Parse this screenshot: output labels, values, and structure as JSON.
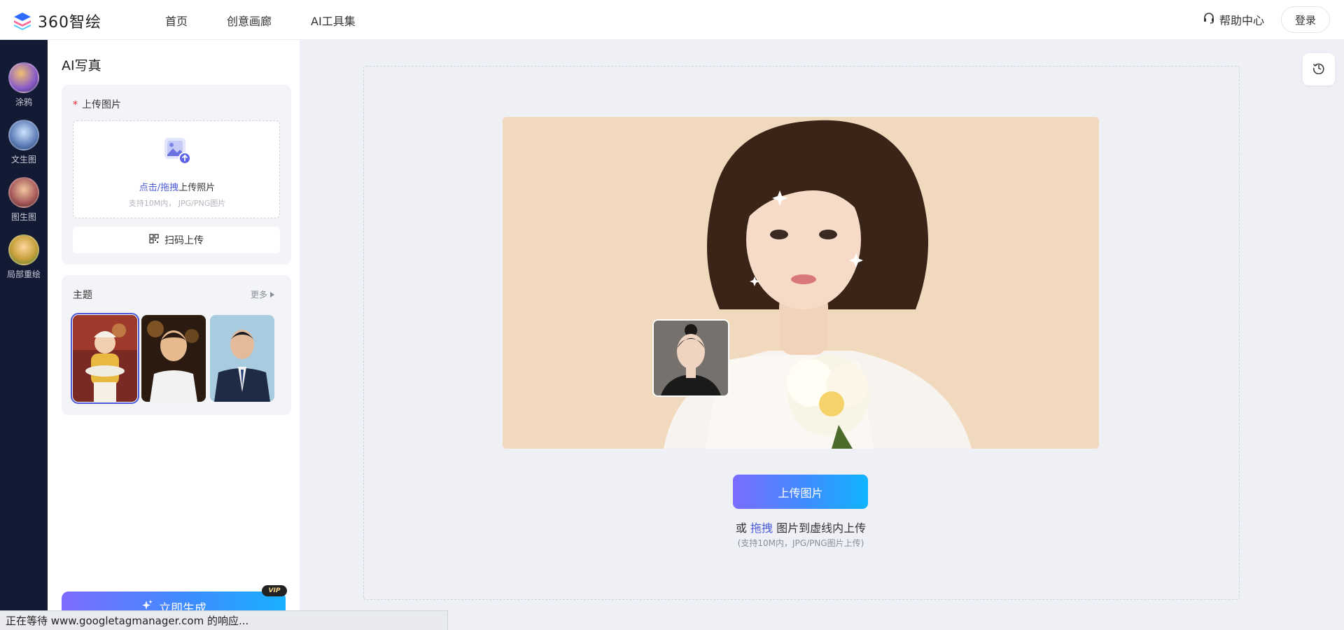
{
  "header": {
    "logo_text": "360智绘",
    "nav": [
      "首页",
      "创意画廊",
      "AI工具集"
    ],
    "help": "帮助中心",
    "login": "登录"
  },
  "rail": [
    {
      "label": "涂鸦",
      "color": "#8a5cc7"
    },
    {
      "label": "文生图",
      "color": "#5f7fb8"
    },
    {
      "label": "图生图",
      "color": "#a65a5a"
    },
    {
      "label": "局部重绘",
      "color": "#c7a13b"
    }
  ],
  "side": {
    "title": "AI写真",
    "upload_label": "上传图片",
    "required_mark": "*",
    "drop_link": "点击/拖拽",
    "drop_text": "上传照片",
    "drop_sub": "支持10M内， JPG/PNG图片",
    "scan_button": "扫码上传",
    "theme_title": "主题",
    "more": "更多",
    "themes": [
      {
        "name": "theme-child-dumplings",
        "selected": true
      },
      {
        "name": "theme-boy-portrait",
        "selected": false
      },
      {
        "name": "theme-man-suit",
        "selected": false
      }
    ],
    "generate_button": "立即生成",
    "vip_badge": "VIP"
  },
  "main": {
    "upload_button": "上传图片",
    "hint_prefix": "或",
    "hint_link": "拖拽",
    "hint_suffix": "图片到虚线内上传",
    "hint_sub": "(支持10M内，JPG/PNG图片上传)"
  },
  "status_bar": "正在等待 www.googletagmanager.com 的响应...",
  "colors": {
    "accent": "#4b5bd8",
    "rail_bg": "#131a33",
    "preview_bg": "#f0d9bd",
    "required": "#f5222d"
  }
}
